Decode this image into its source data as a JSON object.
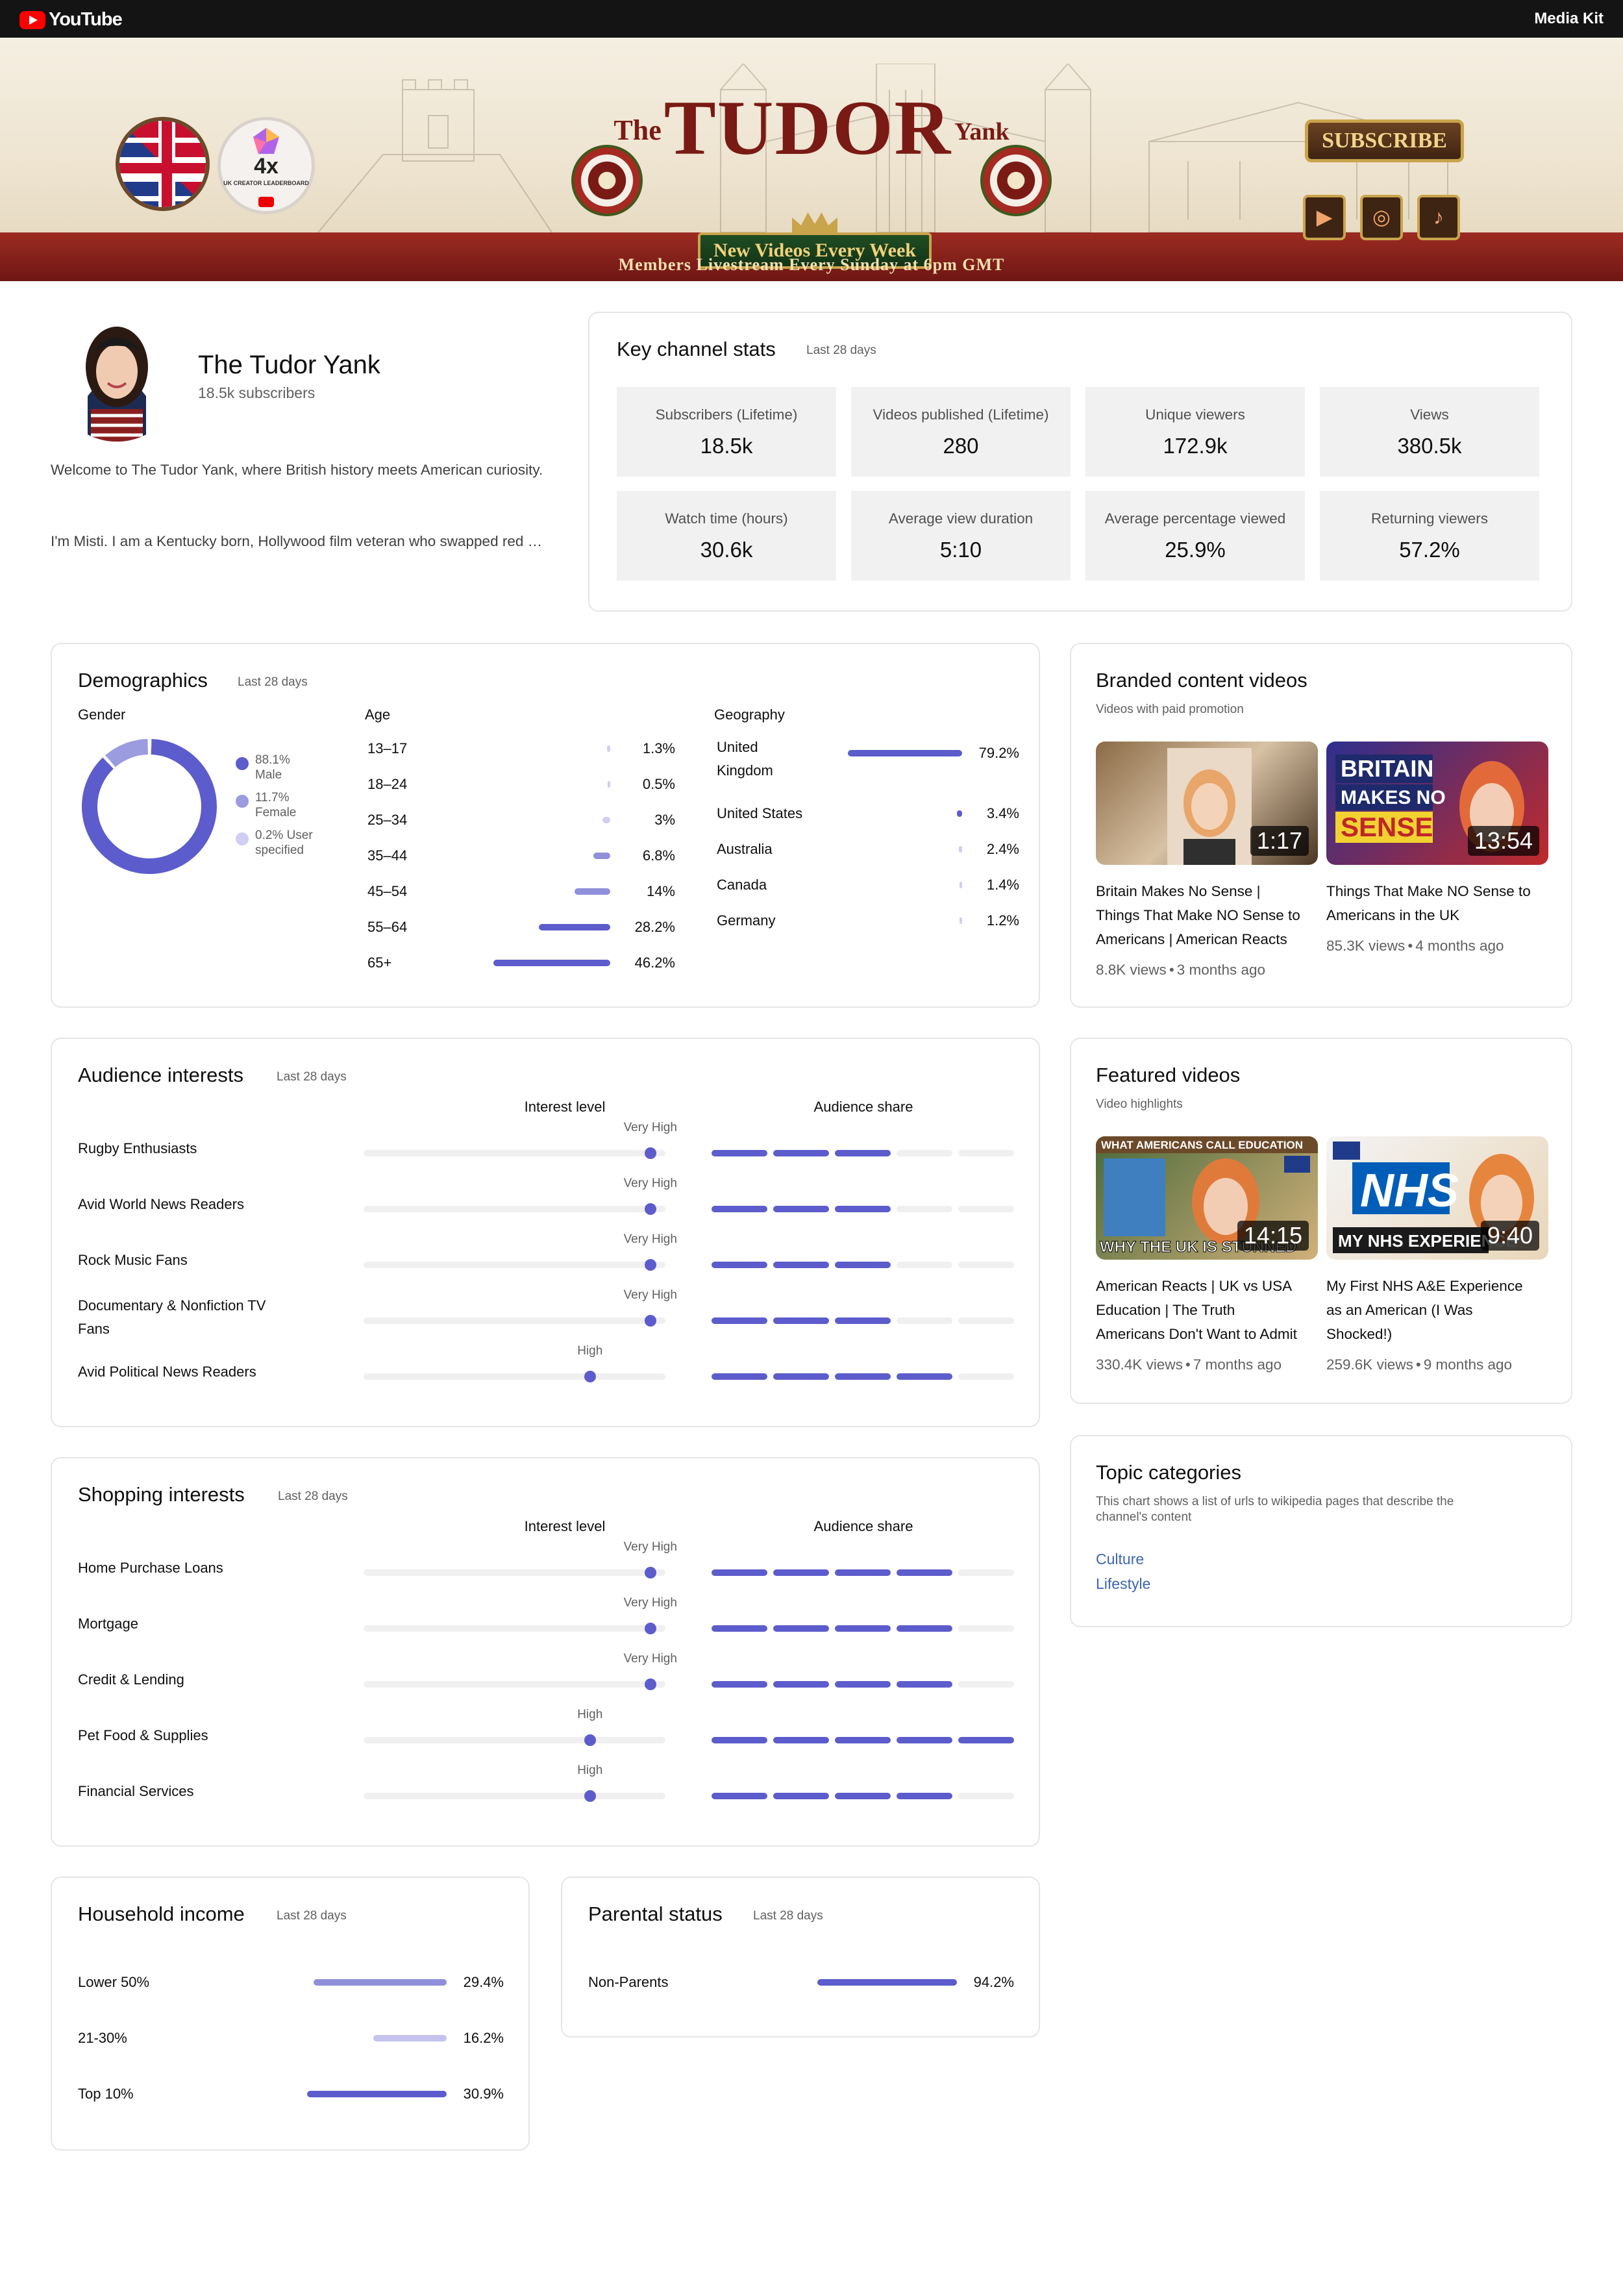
{
  "topbar": {
    "logo_text": "YouTube",
    "media_kit": "Media Kit"
  },
  "banner": {
    "title_the": "The",
    "title_tudor": "TUDOR",
    "title_yank": "Yank",
    "ribbon": "New Videos Every Week",
    "livestream": "Members Livestream Every Sunday at 6pm GMT",
    "subscribe": "SUBSCRIBE",
    "award_text": "4x",
    "award_sub": "UK CREATOR LEADERBOARD",
    "social_icons": [
      "youtube-icon",
      "instagram-icon",
      "tiktok-icon"
    ]
  },
  "profile": {
    "name": "The Tudor Yank",
    "subscribers": "18.5k subscribers",
    "description_1": "Welcome to The Tudor Yank, where British history meets American curiosity.",
    "description_2": "I'm Misti. I am a Kentucky born, Hollywood film veteran who swapped red …"
  },
  "key_stats": {
    "title": "Key channel stats",
    "period": "Last 28 days",
    "tiles": [
      {
        "label": "Subscribers (Lifetime)",
        "value": "18.5k"
      },
      {
        "label": "Videos published (Lifetime)",
        "value": "280"
      },
      {
        "label": "Unique viewers",
        "value": "172.9k"
      },
      {
        "label": "Views",
        "value": "380.5k"
      },
      {
        "label": "Watch time (hours)",
        "value": "30.6k"
      },
      {
        "label": "Average view duration",
        "value": "5:10"
      },
      {
        "label": "Average percentage viewed",
        "value": "25.9%"
      },
      {
        "label": "Returning viewers",
        "value": "57.2%"
      }
    ]
  },
  "demographics": {
    "title": "Demographics",
    "period": "Last 28 days",
    "gender_label": "Gender",
    "gender": [
      {
        "pct": "88.1%",
        "label": "Male",
        "value": 88.1,
        "color": "#5c5ccc"
      },
      {
        "pct": "11.7%",
        "label": "Female",
        "value": 11.7,
        "color": "#9b9be0"
      },
      {
        "pct": "0.2% User",
        "label": "specified",
        "value": 0.2,
        "color": "#cfcff2"
      }
    ],
    "age_label": "Age",
    "age": [
      {
        "label": "13–17",
        "pct": "1.3%",
        "value": 1.3
      },
      {
        "label": "18–24",
        "pct": "0.5%",
        "value": 0.5
      },
      {
        "label": "25–34",
        "pct": "3%",
        "value": 3
      },
      {
        "label": "35–44",
        "pct": "6.8%",
        "value": 6.8
      },
      {
        "label": "45–54",
        "pct": "14%",
        "value": 14
      },
      {
        "label": "55–64",
        "pct": "28.2%",
        "value": 28.2
      },
      {
        "label": "65+",
        "pct": "46.2%",
        "value": 46.2
      }
    ],
    "geo_label": "Geography",
    "geography": [
      {
        "label_1": "United",
        "label_2": "Kingdom",
        "pct": "79.2%",
        "value": 79.2
      },
      {
        "label_1": "United States",
        "label_2": "",
        "pct": "3.4%",
        "value": 3.4
      },
      {
        "label_1": "Australia",
        "label_2": "",
        "pct": "2.4%",
        "value": 2.4
      },
      {
        "label_1": "Canada",
        "label_2": "",
        "pct": "1.4%",
        "value": 1.4
      },
      {
        "label_1": "Germany",
        "label_2": "",
        "pct": "1.2%",
        "value": 1.2
      }
    ]
  },
  "branded": {
    "title": "Branded content videos",
    "subtitle": "Videos with paid promotion",
    "videos": [
      {
        "duration": "1:17",
        "title_lines": [
          "Britain Makes No Sense |",
          "Things That Make NO Sense to",
          "Americans | American Reacts"
        ],
        "views": "8.8K views",
        "age": "3 months ago",
        "thumb_text": ""
      },
      {
        "duration": "13:54",
        "title_lines": [
          "Things That Make NO Sense to",
          "Americans in the UK"
        ],
        "views": "85.3K views",
        "age": "4 months ago",
        "thumb_text": "BRITAIN MAKES NO SENSE"
      }
    ]
  },
  "audience_interests": {
    "title": "Audience interests",
    "period": "Last 28 days",
    "col_level": "Interest level",
    "col_share": "Audience share",
    "rows": [
      {
        "label_1": "Rugby Enthusiasts",
        "label_2": "",
        "level": "Very High",
        "level_value": 0.95,
        "share": 3
      },
      {
        "label_1": "Avid World News Readers",
        "label_2": "",
        "level": "Very High",
        "level_value": 0.95,
        "share": 3
      },
      {
        "label_1": "Rock Music Fans",
        "label_2": "",
        "level": "Very High",
        "level_value": 0.95,
        "share": 3
      },
      {
        "label_1": "Documentary & Nonfiction TV",
        "label_2": "Fans",
        "level": "Very High",
        "level_value": 0.95,
        "share": 3
      },
      {
        "label_1": "Avid Political News Readers",
        "label_2": "",
        "level": "High",
        "level_value": 0.75,
        "share": 4
      }
    ]
  },
  "featured": {
    "title": "Featured videos",
    "subtitle": "Video highlights",
    "videos": [
      {
        "duration": "14:15",
        "title_lines": [
          "American Reacts | UK vs USA",
          "Education | The Truth",
          "Americans Don't Want to Admit"
        ],
        "views": "330.4K views",
        "age": "7 months ago",
        "thumb_text": "WHY THE UK IS STUNNED"
      },
      {
        "duration": "9:40",
        "title_lines": [
          "My First NHS A&E Experience",
          "as an American (I Was",
          "Shocked!)"
        ],
        "views": "259.6K views",
        "age": "9 months ago",
        "thumb_text": "NHS"
      }
    ]
  },
  "shopping_interests": {
    "title": "Shopping interests",
    "period": "Last 28 days",
    "col_level": "Interest level",
    "col_share": "Audience share",
    "rows": [
      {
        "label": "Home Purchase Loans",
        "level": "Very High",
        "level_value": 0.95,
        "share": 4
      },
      {
        "label": "Mortgage",
        "level": "Very High",
        "level_value": 0.95,
        "share": 4
      },
      {
        "label": "Credit & Lending",
        "level": "Very High",
        "level_value": 0.95,
        "share": 4
      },
      {
        "label": "Pet Food & Supplies",
        "level": "High",
        "level_value": 0.75,
        "share": 5
      },
      {
        "label": "Financial Services",
        "level": "High",
        "level_value": 0.75,
        "share": 4
      }
    ]
  },
  "topics": {
    "title": "Topic categories",
    "subtitle_1": "This chart shows a list of urls to wikipedia pages that describe the",
    "subtitle_2": "channel's content",
    "links": [
      "Culture",
      "Lifestyle"
    ]
  },
  "household": {
    "title": "Household income",
    "period": "Last 28 days",
    "rows": [
      {
        "label": "Lower 50%",
        "pct": "29.4%",
        "value": 29.4,
        "color": "#8f8fdb"
      },
      {
        "label": "21-30%",
        "pct": "16.2%",
        "value": 16.2,
        "color": "#c3c3ee"
      },
      {
        "label": "Top 10%",
        "pct": "30.9%",
        "value": 30.9,
        "color": "#5c5ccc"
      }
    ]
  },
  "parental": {
    "title": "Parental status",
    "period": "Last 28 days",
    "rows": [
      {
        "label": "Non-Parents",
        "pct": "94.2%",
        "value": 94.2
      }
    ]
  }
}
